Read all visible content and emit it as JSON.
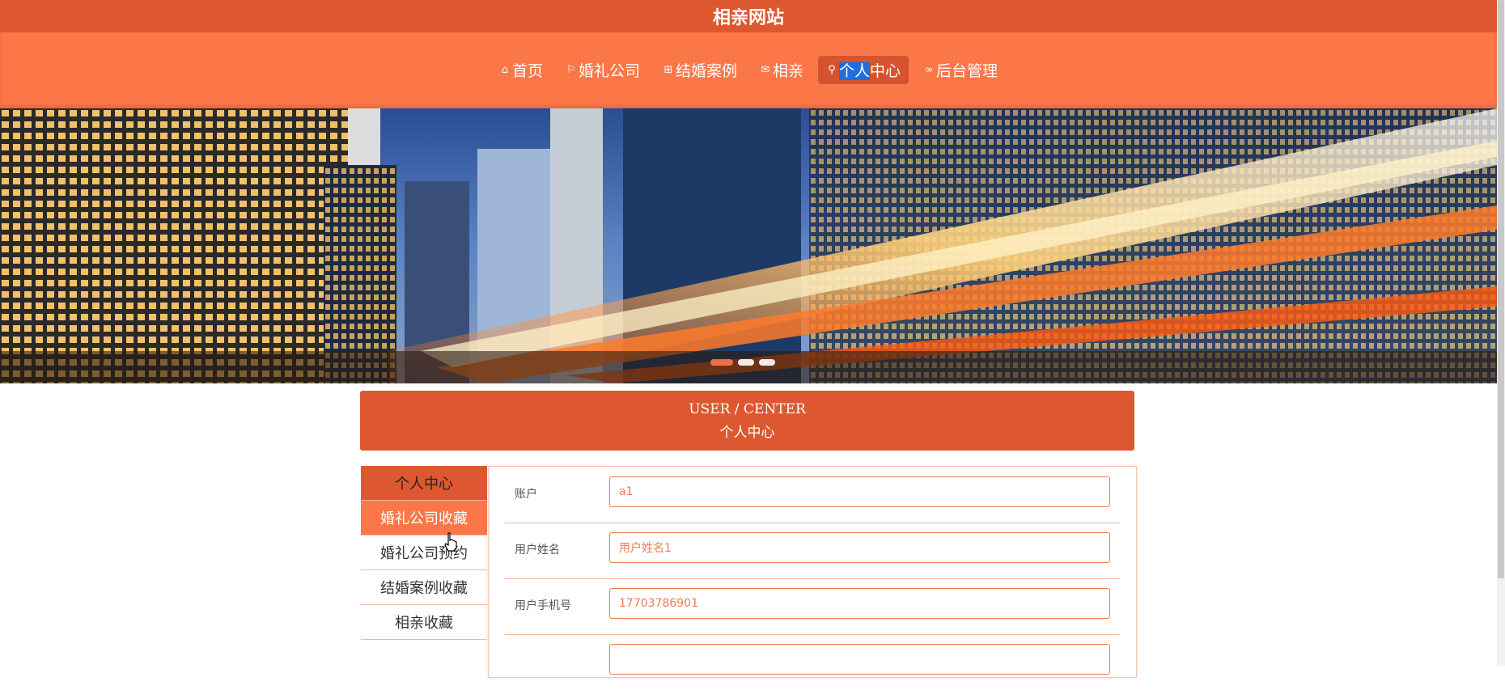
{
  "site": {
    "title": "相亲网站"
  },
  "nav": [
    {
      "label": "首页",
      "icon": "home-icon",
      "glyph": "⌂"
    },
    {
      "label": "婚礼公司",
      "icon": "flag-icon",
      "glyph": "⚐"
    },
    {
      "label": "结婚案例",
      "icon": "gift-icon",
      "glyph": "⊞"
    },
    {
      "label": "相亲",
      "icon": "mail-icon",
      "glyph": "✉"
    },
    {
      "label_pre": "",
      "label_hl": "个人",
      "label_post": "中心",
      "icon": "user-icon",
      "glyph": "⚲",
      "active": true
    },
    {
      "label": "后台管理",
      "icon": "link-icon",
      "glyph": "∞"
    }
  ],
  "banner": {
    "slides": 3,
    "active_slide": 1
  },
  "section": {
    "en": "USER / CENTER",
    "cn": "个人中心"
  },
  "side_menu": [
    {
      "label": "个人中心",
      "type": "header"
    },
    {
      "label": "婚礼公司收藏",
      "active": true
    },
    {
      "label": "婚礼公司预约"
    },
    {
      "label": "结婚案例收藏"
    },
    {
      "label": "相亲收藏"
    }
  ],
  "form": [
    {
      "label": "账户",
      "value": "a1"
    },
    {
      "label": "用户姓名",
      "value": "用户姓名1"
    },
    {
      "label": "用户手机号",
      "value": "17703786901"
    },
    {
      "label": "",
      "value": ""
    }
  ],
  "colors": {
    "primary": "#dd5830",
    "accent": "#fb7748",
    "highlight": "#1f6ee0"
  }
}
